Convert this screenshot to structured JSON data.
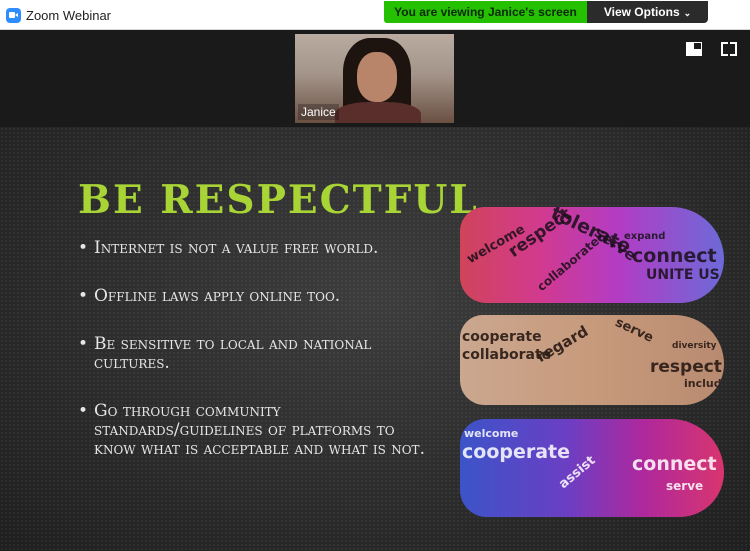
{
  "window": {
    "title": "Zoom Webinar"
  },
  "banner": {
    "text": "You are viewing Janice's screen"
  },
  "view_options": {
    "label": "View Options",
    "icon": "chevron-down-icon"
  },
  "video": {
    "participant_name": "Janice"
  },
  "toolbar_icons": [
    "split-view-icon",
    "fullscreen-icon"
  ],
  "slide": {
    "title": "BE RESPECTFUL",
    "bullets": [
      "Internet is not a value free world.",
      "Offline laws apply online too.",
      "Be sensitive to local and national cultures.",
      "Go through community standards/guidelines of platforms to know what is acceptable and what is not."
    ],
    "artwork_words": {
      "hand1": [
        "welcome",
        "respect",
        "tolerate",
        "serve",
        "collaborate",
        "connect",
        "UNITE US",
        "expand"
      ],
      "hand2": [
        "cooperate",
        "collaborate",
        "regard",
        "serve",
        "respect",
        "include",
        "diversity"
      ],
      "hand3": [
        "cooperate",
        "welcome",
        "assist",
        "connect",
        "serve"
      ]
    }
  },
  "colors": {
    "title_green": "#a8d435",
    "banner_green": "#25c000",
    "zoom_blue": "#2d8cff"
  }
}
